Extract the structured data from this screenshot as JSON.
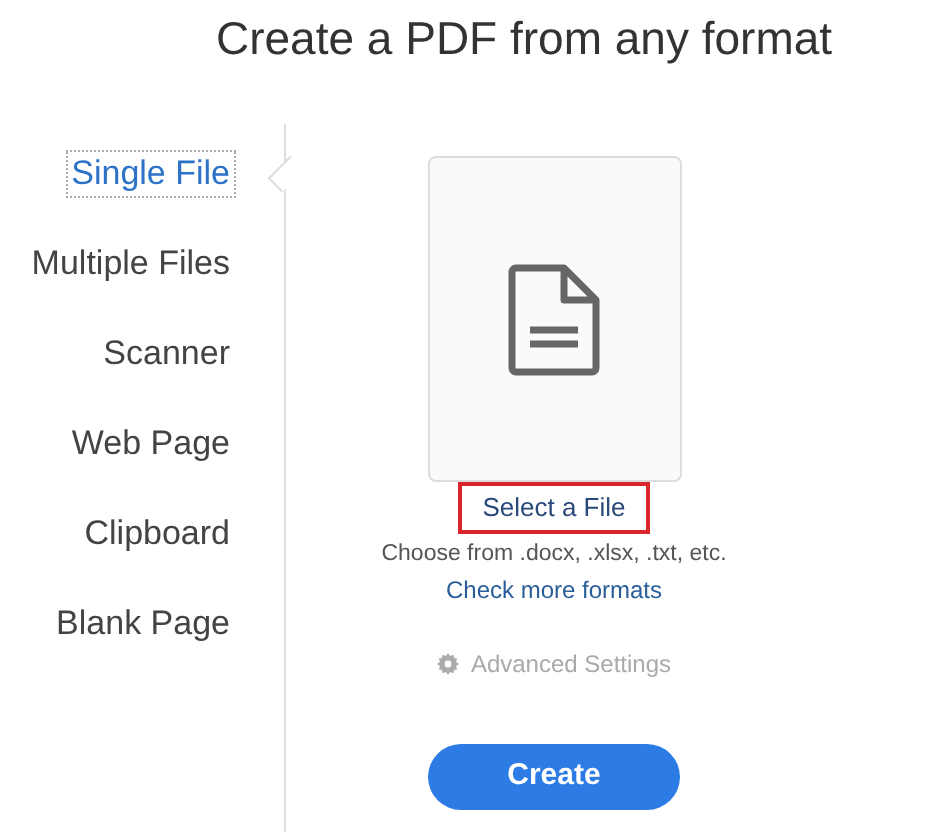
{
  "title": "Create a PDF from any format",
  "sidebar": {
    "items": [
      {
        "label": "Single File",
        "selected": true
      },
      {
        "label": "Multiple Files",
        "selected": false
      },
      {
        "label": "Scanner",
        "selected": false
      },
      {
        "label": "Web Page",
        "selected": false
      },
      {
        "label": "Clipboard",
        "selected": false
      },
      {
        "label": "Blank Page",
        "selected": false
      }
    ]
  },
  "file_drop": {
    "button": "Select a File",
    "highlighted": true,
    "hint": "Choose from .docx, .xlsx, .txt, etc.",
    "link": "Check more formats"
  },
  "advanced_settings": {
    "label": "Advanced Settings",
    "disabled": true
  },
  "create_button": "Create"
}
